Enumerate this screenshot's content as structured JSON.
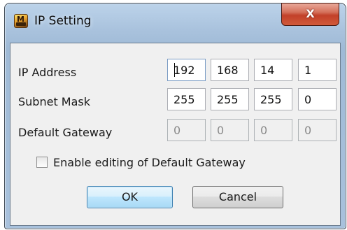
{
  "window": {
    "title": "IP Setting",
    "close_symbol": "X",
    "app_icon_letter": "M"
  },
  "fields": [
    {
      "label": "IP Address",
      "octets": [
        "192",
        "168",
        "14",
        "1"
      ],
      "enabled": true
    },
    {
      "label": "Subnet Mask",
      "octets": [
        "255",
        "255",
        "255",
        "0"
      ],
      "enabled": true
    },
    {
      "label": "Default Gateway",
      "octets": [
        "0",
        "0",
        "0",
        "0"
      ],
      "enabled": false
    }
  ],
  "checkbox": {
    "label": "Enable editing of Default Gateway",
    "checked": false
  },
  "buttons": {
    "ok_label": "OK",
    "cancel_label": "Cancel"
  },
  "colors": {
    "titlebar": "#a9c2dd",
    "close_button": "#c24029",
    "dialog_background": "#f0f0f0",
    "ok_button": "#bee6fd"
  },
  "icons": {
    "app": "app-logo-icon",
    "close": "close-icon"
  }
}
